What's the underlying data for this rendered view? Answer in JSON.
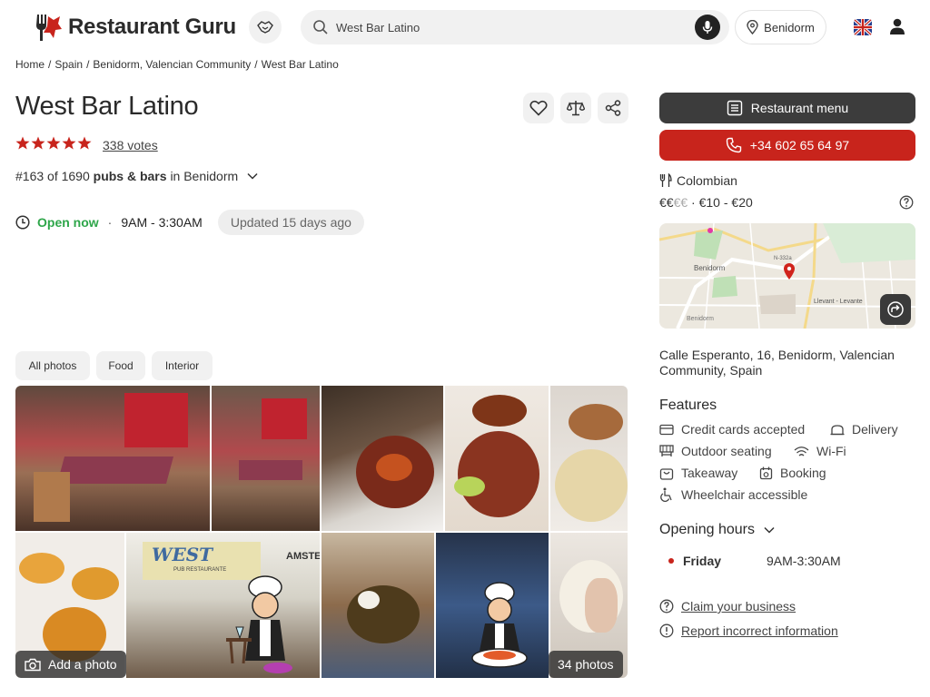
{
  "header": {
    "logo_text": "Restaurant Guru",
    "search_value": "West Bar Latino",
    "location": "Benidorm"
  },
  "breadcrumb": [
    "Home",
    "Spain",
    "Benidorm, Valencian Community",
    "West Bar Latino"
  ],
  "restaurant": {
    "name": "West Bar Latino",
    "rating_stars": 5,
    "votes": "338 votes",
    "rank_prefix": "#163 of 1690",
    "rank_category": "pubs & bars",
    "rank_suffix": "in Benidorm",
    "open_status": "Open now",
    "hours_today": "9AM - 3:30AM",
    "updated": "Updated 15 days ago"
  },
  "photo_tabs": [
    "All photos",
    "Food",
    "Interior"
  ],
  "gallery": {
    "add_photo": "Add a photo",
    "photo_count": "34 photos",
    "sign_text": "WEST",
    "sign_sub": "PUB RESTAURANTE",
    "sign_right": "AMSTE"
  },
  "sidebar": {
    "menu_button": "Restaurant menu",
    "phone_button": "+34 602 65 64 97",
    "cuisine": "Colombian",
    "price_level_active": "€€",
    "price_level_inactive": "€€",
    "price_range": "€10 - €20",
    "address": "Calle Esperanto, 16, Benidorm, Valencian Community, Spain",
    "map_labels": [
      "Benidorm",
      "Llevant - Levante",
      "N-332a",
      "Benidorm"
    ],
    "features_title": "Features",
    "features": {
      "credit_cards": "Credit cards accepted",
      "delivery": "Delivery",
      "outdoor": "Outdoor seating",
      "wifi": "Wi-Fi",
      "takeaway": "Takeaway",
      "booking": "Booking",
      "wheelchair": "Wheelchair accessible"
    },
    "opening_hours_title": "Opening hours",
    "opening_day": "Friday",
    "opening_time": "9AM-3:30AM",
    "claim_link": "Claim your business",
    "report_link": "Report incorrect information"
  },
  "colors": {
    "brand_red": "#c8241c",
    "open_green": "#2ea64a",
    "dark_button": "#3c3c3c"
  }
}
